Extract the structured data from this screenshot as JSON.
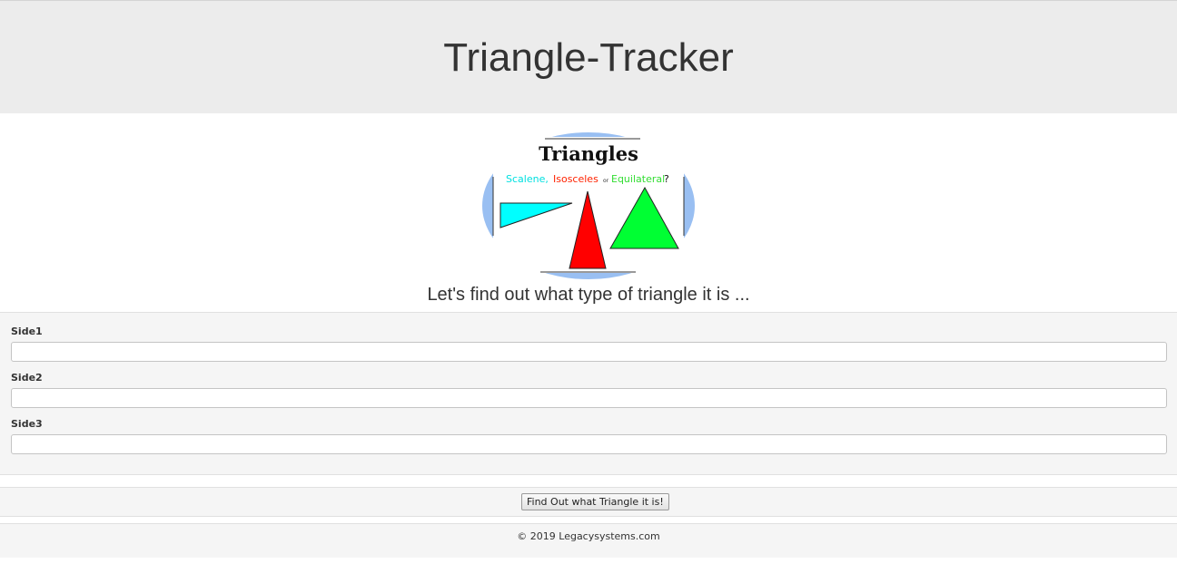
{
  "header": {
    "title": "Triangle-Tracker"
  },
  "logo": {
    "heading": "Triangles",
    "word_scalene": "Scalene,",
    "word_isosceles": "Isosceles",
    "word_or": "or",
    "word_equilateral": "Equilateral",
    "question_mark": "?",
    "colors": {
      "ellipse": "#99bff2",
      "scalene": "#00ffff",
      "isosceles": "#ff0000",
      "equilateral": "#00ff33"
    }
  },
  "subtitle": "Let's find out what type of triangle it is ...",
  "form": {
    "side1": {
      "label": "Side1",
      "value": ""
    },
    "side2": {
      "label": "Side2",
      "value": ""
    },
    "side3": {
      "label": "Side3",
      "value": ""
    }
  },
  "actions": {
    "submit_label": "Find Out what Triangle it is!"
  },
  "footer": {
    "text": "© 2019 Legacysystems.com"
  }
}
